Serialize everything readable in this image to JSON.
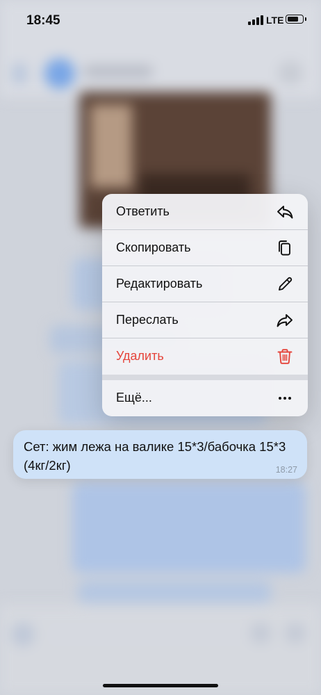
{
  "status_bar": {
    "time": "18:45",
    "network": "LTE",
    "battery_icon": "battery-icon",
    "signal_icon": "signal-icon"
  },
  "context_menu": {
    "items": [
      {
        "label": "Ответить",
        "icon": "reply-icon",
        "danger": false
      },
      {
        "label": "Скопировать",
        "icon": "copy-icon",
        "danger": false
      },
      {
        "label": "Редактировать",
        "icon": "pencil-icon",
        "danger": false
      },
      {
        "label": "Переслать",
        "icon": "forward-icon",
        "danger": false
      },
      {
        "label": "Удалить",
        "icon": "trash-icon",
        "danger": true
      }
    ],
    "more": {
      "label": "Ещё...",
      "icon": "ellipsis-icon"
    }
  },
  "message": {
    "text": "Сет: жим лежа на валике 15*3/бабочка 15*3 (4кг/2кг)",
    "time": "18:27"
  },
  "colors": {
    "danger": "#e5443b",
    "bubble": "#cfe2f8",
    "menu_bg": "#f2f3f6",
    "text": "#111111",
    "timestamp": "#8e9aa8"
  }
}
